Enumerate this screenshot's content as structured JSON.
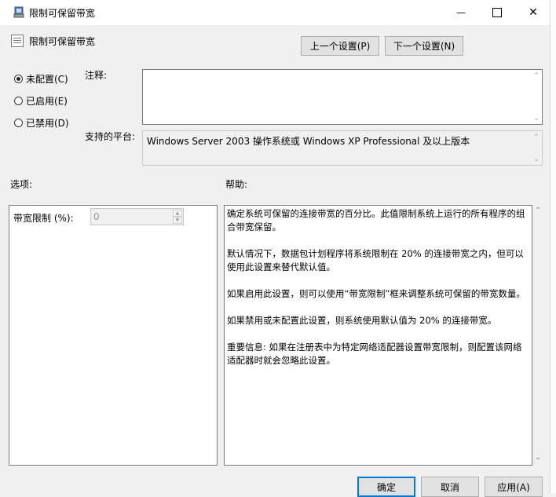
{
  "window": {
    "title": "限制可保留带宽",
    "minimize_glyph": "—",
    "maximize_glyph": "☐",
    "close_glyph": "✕"
  },
  "header": {
    "policy_name": "限制可保留带宽",
    "prev_button": "上一个设置(P)",
    "next_button": "下一个设置(N)"
  },
  "state_options": [
    {
      "label": "未配置(C)",
      "selected": true
    },
    {
      "label": "已启用(E)",
      "selected": false
    },
    {
      "label": "已禁用(D)",
      "selected": false
    }
  ],
  "comment": {
    "label": "注释:",
    "value": ""
  },
  "platform": {
    "label": "支持的平台:",
    "value": "Windows Server 2003 操作系统或 Windows XP Professional 及以上版本"
  },
  "options": {
    "label": "选项:",
    "bandwidth_label": "带宽限制 (%):",
    "bandwidth_value": "0"
  },
  "help": {
    "label": "帮助:",
    "paragraphs": [
      "确定系统可保留的连接带宽的百分比。此值限制系统上运行的所有程序的组合带宽保留。",
      "默认情况下，数据包计划程序将系统限制在 20% 的连接带宽之内，但可以使用此设置来替代默认值。",
      "如果启用此设置，则可以使用“带宽限制”框来调整系统可保留的带宽数量。",
      "如果禁用或未配置此设置，则系统使用默认值为 20% 的连接带宽。",
      "重要信息: 如果在注册表中为特定网络适配器设置带宽限制，则配置该网络适配器时就会忽略此设置。"
    ]
  },
  "footer": {
    "ok": "确定",
    "cancel": "取消",
    "apply": "应用(A)"
  }
}
